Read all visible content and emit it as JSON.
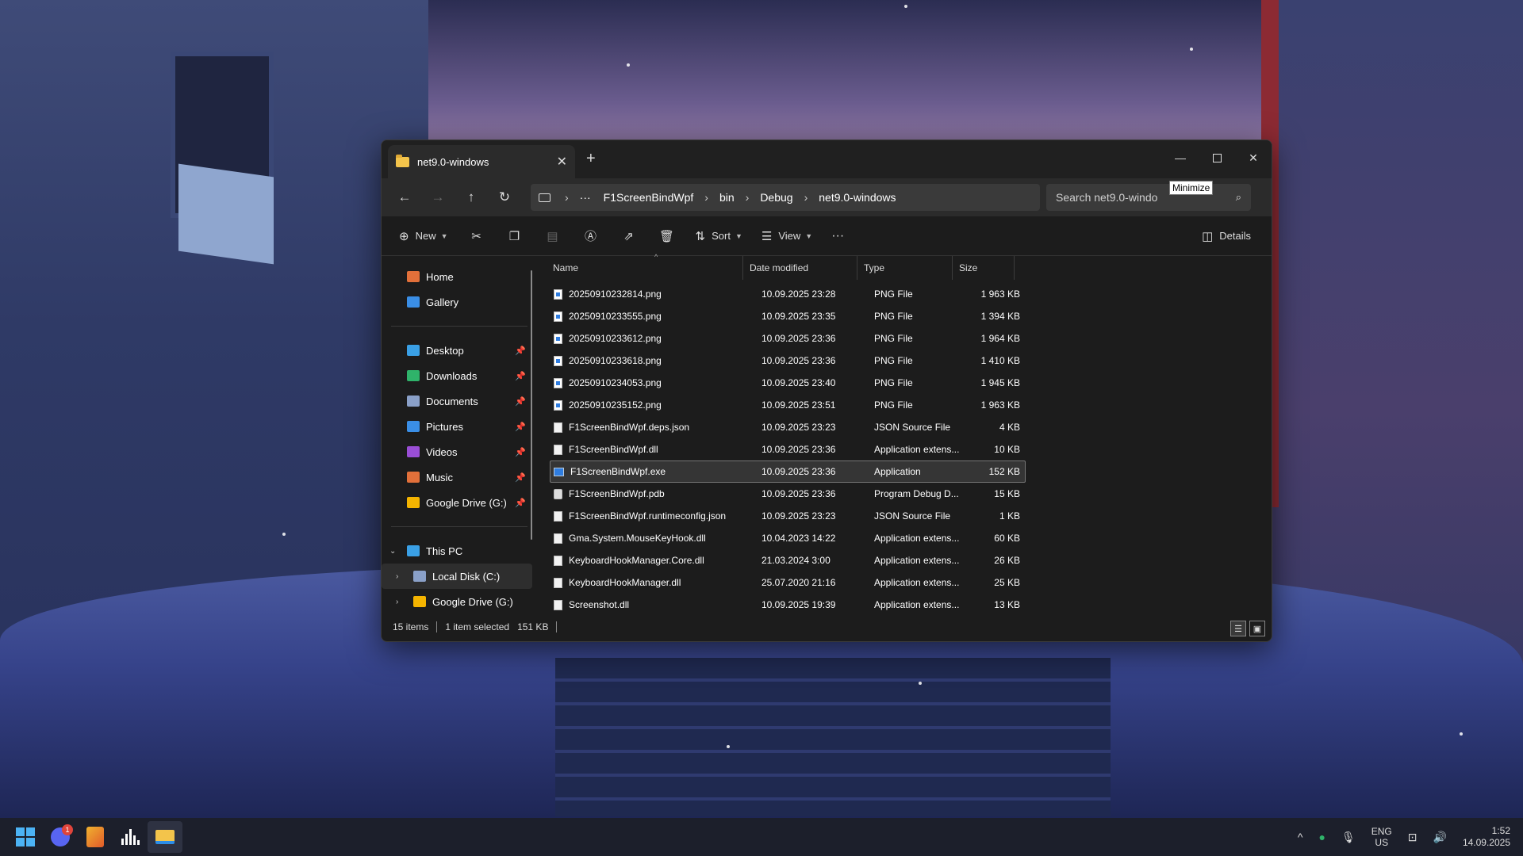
{
  "window": {
    "tab_title": "net9.0-windows",
    "tooltip": "Minimize"
  },
  "navbar": {
    "breadcrumb_more": "···",
    "breadcrumb": [
      "F1ScreenBindWpf",
      "bin",
      "Debug",
      "net9.0-windows"
    ],
    "search_placeholder": "Search net9.0-windo"
  },
  "toolbar": {
    "new_label": "New",
    "sort_label": "Sort",
    "view_label": "View",
    "more_label": "···",
    "details_label": "Details"
  },
  "sidebar": {
    "quick": [
      {
        "label": "Home",
        "icon": "home-icon",
        "color": "#e2703a"
      },
      {
        "label": "Gallery",
        "icon": "gallery-icon",
        "color": "#3a8ee6"
      }
    ],
    "pinned": [
      {
        "label": "Desktop",
        "icon": "desktop-icon",
        "color": "#3aa0e6"
      },
      {
        "label": "Downloads",
        "icon": "downloads-icon",
        "color": "#2fb36a"
      },
      {
        "label": "Documents",
        "icon": "documents-icon",
        "color": "#8aa0c8"
      },
      {
        "label": "Pictures",
        "icon": "pictures-icon",
        "color": "#3a8ee6"
      },
      {
        "label": "Videos",
        "icon": "videos-icon",
        "color": "#9a4ed6"
      },
      {
        "label": "Music",
        "icon": "music-icon",
        "color": "#e2703a"
      },
      {
        "label": "Google Drive (G:)",
        "icon": "google-drive-icon",
        "color": "#f4b400"
      }
    ],
    "this_pc": "This PC",
    "drives": [
      {
        "label": "Local Disk (C:)",
        "icon": "local-disk-icon",
        "color": "#8aa0c8"
      },
      {
        "label": "Google Drive (G:)",
        "icon": "google-drive-icon",
        "color": "#f4b400"
      }
    ]
  },
  "columns": {
    "name": "Name",
    "date": "Date modified",
    "type": "Type",
    "size": "Size"
  },
  "files": [
    {
      "name": "20250910232814.png",
      "date": "10.09.2025 23:28",
      "type": "PNG File",
      "size": "1 963 KB",
      "kind": "png"
    },
    {
      "name": "20250910233555.png",
      "date": "10.09.2025 23:35",
      "type": "PNG File",
      "size": "1 394 KB",
      "kind": "png"
    },
    {
      "name": "20250910233612.png",
      "date": "10.09.2025 23:36",
      "type": "PNG File",
      "size": "1 964 KB",
      "kind": "png"
    },
    {
      "name": "20250910233618.png",
      "date": "10.09.2025 23:36",
      "type": "PNG File",
      "size": "1 410 KB",
      "kind": "png"
    },
    {
      "name": "20250910234053.png",
      "date": "10.09.2025 23:40",
      "type": "PNG File",
      "size": "1 945 KB",
      "kind": "png"
    },
    {
      "name": "20250910235152.png",
      "date": "10.09.2025 23:51",
      "type": "PNG File",
      "size": "1 963 KB",
      "kind": "png"
    },
    {
      "name": "F1ScreenBindWpf.deps.json",
      "date": "10.09.2025 23:23",
      "type": "JSON Source File",
      "size": "4 KB",
      "kind": "file"
    },
    {
      "name": "F1ScreenBindWpf.dll",
      "date": "10.09.2025 23:36",
      "type": "Application extens...",
      "size": "10 KB",
      "kind": "file"
    },
    {
      "name": "F1ScreenBindWpf.exe",
      "date": "10.09.2025 23:36",
      "type": "Application",
      "size": "152 KB",
      "kind": "exe",
      "selected": true
    },
    {
      "name": "F1ScreenBindWpf.pdb",
      "date": "10.09.2025 23:36",
      "type": "Program Debug D...",
      "size": "15 KB",
      "kind": "pdb"
    },
    {
      "name": "F1ScreenBindWpf.runtimeconfig.json",
      "date": "10.09.2025 23:23",
      "type": "JSON Source File",
      "size": "1 KB",
      "kind": "file"
    },
    {
      "name": "Gma.System.MouseKeyHook.dll",
      "date": "10.04.2023 14:22",
      "type": "Application extens...",
      "size": "60 KB",
      "kind": "file"
    },
    {
      "name": "KeyboardHookManager.Core.dll",
      "date": "21.03.2024 3:00",
      "type": "Application extens...",
      "size": "26 KB",
      "kind": "file"
    },
    {
      "name": "KeyboardHookManager.dll",
      "date": "25.07.2020 21:16",
      "type": "Application extens...",
      "size": "25 KB",
      "kind": "file"
    },
    {
      "name": "Screenshot.dll",
      "date": "10.09.2025 19:39",
      "type": "Application extens...",
      "size": "13 KB",
      "kind": "file"
    }
  ],
  "status": {
    "items": "15 items",
    "selected": "1 item selected",
    "selected_size": "151 KB"
  },
  "taskbar": {
    "discord_badge": "1",
    "lang_top": "ENG",
    "lang_bottom": "US",
    "time": "1:52",
    "date": "14.09.2025"
  }
}
